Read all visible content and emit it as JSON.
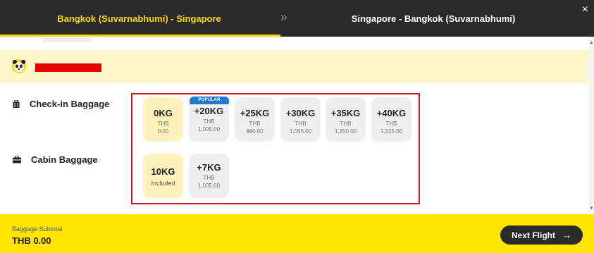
{
  "header": {
    "outbound_tab": "Bangkok (Suvarnabhumi) - Singapore",
    "separator": "»",
    "return_tab": "Singapore - Bangkok (Suvarnabhumi)",
    "close_icon": "×"
  },
  "passenger": {
    "avatar_icon": "panda-avatar-icon",
    "name": "[redacted]"
  },
  "checkin": {
    "label": "Check-in Baggage",
    "icon": "suitcase-icon",
    "options": [
      {
        "weight": "0KG",
        "currency": "THB",
        "price": "0.00",
        "selected": true
      },
      {
        "weight": "+20KG",
        "currency": "THB",
        "price": "1,005.00",
        "badge": "POPULAR"
      },
      {
        "weight": "+25KG",
        "currency": "THB",
        "price": "980.00"
      },
      {
        "weight": "+30KG",
        "currency": "THB",
        "price": "1,055.00"
      },
      {
        "weight": "+35KG",
        "currency": "THB",
        "price": "1,250.00"
      },
      {
        "weight": "+40KG",
        "currency": "THB",
        "price": "1,525.00"
      }
    ]
  },
  "cabin": {
    "label": "Cabin Baggage",
    "icon": "briefcase-icon",
    "options": [
      {
        "weight": "10KG",
        "note": "Included",
        "selected": true
      },
      {
        "weight": "+7KG",
        "currency": "THB",
        "price": "1,005.00"
      }
    ]
  },
  "footer": {
    "subtotal_label": "Baggage Subtotal",
    "subtotal_value": "THB 0.00",
    "next_button": "Next Flight",
    "next_icon": "→"
  },
  "colors": {
    "brand_yellow": "#ffe500",
    "header_bg": "#2a2a2a",
    "selected_bg": "#fff2bd",
    "popular_badge": "#1b7bd4",
    "annotation_frame": "#d0191d"
  }
}
